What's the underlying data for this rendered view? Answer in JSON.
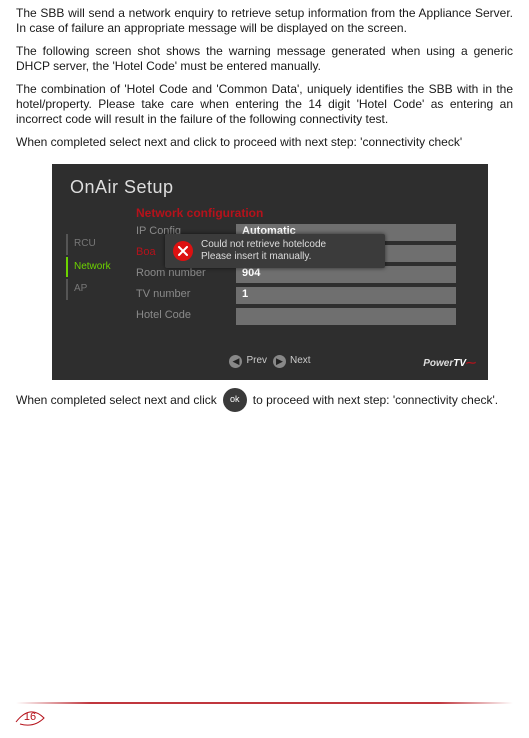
{
  "intro": {
    "p1": "The SBB will send a network enquiry to retrieve setup information from the Appliance Server. In case of failure an appropriate message will be displayed on the screen.",
    "p2": "The following screen shot shows the warning message generated when using a generic DHCP server, the 'Hotel Code' must be entered manually.",
    "p3": "The combination of 'Hotel Code and 'Common Data', uniquely identifies the SBB with in the hotel/property. Please take care when entering the 14 digit 'Hotel Code' as entering an incorrect code will result in the failure of the following connectivity test.",
    "p4": "When completed select next and click to proceed with next step: 'connectivity check'"
  },
  "screenshot": {
    "title": "OnAir Setup",
    "section_title": "Network configuration",
    "sidebar": [
      "RCU",
      "Network",
      "AP"
    ],
    "sidebar_active_index": 1,
    "rows": [
      {
        "label": "IP Config",
        "value": "Automatic",
        "label_red": false
      },
      {
        "label": "Boa",
        "value": "",
        "label_red": true
      },
      {
        "label": "Room number",
        "value": "904",
        "label_red": false
      },
      {
        "label": "TV number",
        "value": "1",
        "label_red": false
      },
      {
        "label": "Hotel Code",
        "value": "",
        "label_red": false
      }
    ],
    "popup": {
      "line1": "Could not retrieve hotelcode",
      "line2": "Please insert it manually."
    },
    "nav": {
      "prev": "Prev",
      "next": "Next"
    },
    "logo": {
      "power": "Power",
      "tv": "TV"
    }
  },
  "finish": {
    "before": "When completed  select next and click",
    "ok": "ok",
    "after": "to proceed with next step: 'connectivity check'."
  },
  "page_number": "16"
}
